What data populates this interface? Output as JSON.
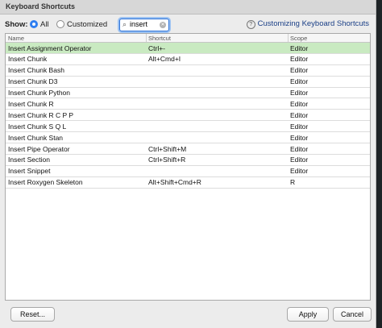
{
  "window": {
    "title": "Keyboard Shortcuts"
  },
  "filter": {
    "show_label": "Show:",
    "options": [
      {
        "label": "All",
        "selected": true
      },
      {
        "label": "Customized",
        "selected": false
      }
    ],
    "search_value": "insert",
    "help_link": "Customizing Keyboard Shortcuts"
  },
  "table": {
    "columns": [
      "Name",
      "Shortcut",
      "Scope"
    ],
    "rows": [
      {
        "name": "Insert Assignment Operator",
        "shortcut": "Ctrl+-",
        "scope": "Editor",
        "selected": true
      },
      {
        "name": "Insert Chunk",
        "shortcut": "Alt+Cmd+I",
        "scope": "Editor"
      },
      {
        "name": "Insert Chunk Bash",
        "shortcut": "",
        "scope": "Editor"
      },
      {
        "name": "Insert Chunk D3",
        "shortcut": "",
        "scope": "Editor"
      },
      {
        "name": "Insert Chunk Python",
        "shortcut": "",
        "scope": "Editor"
      },
      {
        "name": "Insert Chunk R",
        "shortcut": "",
        "scope": "Editor"
      },
      {
        "name": "Insert Chunk R C P P",
        "shortcut": "",
        "scope": "Editor"
      },
      {
        "name": "Insert Chunk S Q L",
        "shortcut": "",
        "scope": "Editor"
      },
      {
        "name": "Insert Chunk Stan",
        "shortcut": "",
        "scope": "Editor"
      },
      {
        "name": "Insert Pipe Operator",
        "shortcut": "Ctrl+Shift+M",
        "scope": "Editor"
      },
      {
        "name": "Insert Section",
        "shortcut": "Ctrl+Shift+R",
        "scope": "Editor"
      },
      {
        "name": "Insert Snippet",
        "shortcut": "",
        "scope": "Editor"
      },
      {
        "name": "Insert Roxygen Skeleton",
        "shortcut": "Alt+Shift+Cmd+R",
        "scope": "R"
      }
    ]
  },
  "buttons": {
    "reset": "Reset...",
    "apply": "Apply",
    "cancel": "Cancel"
  },
  "colors": {
    "accent": "#2e7ef0",
    "selected_row": "#c9eac1",
    "link": "#1a3f86"
  }
}
